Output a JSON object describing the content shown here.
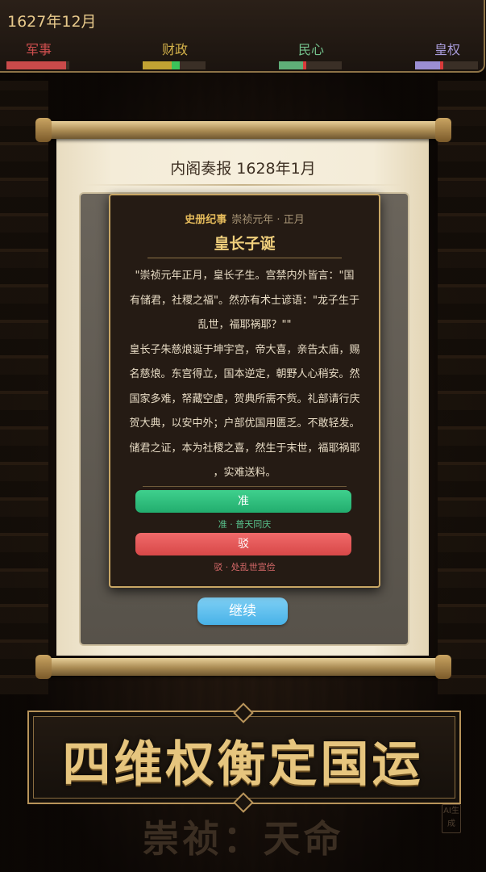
{
  "top_bar": {
    "date": "1627年12月",
    "stats": [
      {
        "label": "军事",
        "color": "#c94a4a",
        "fill_fraction": 0.95,
        "tick_color": null
      },
      {
        "label": "财政",
        "color": "#c2a233",
        "fill_fraction": 0.46,
        "tick_color": "#3cc45a"
      },
      {
        "label": "民心",
        "color": "#5fae78",
        "fill_fraction": 0.38,
        "tick_color": "#d83b3b"
      },
      {
        "label": "皇权",
        "color": "#9b8ed3",
        "fill_fraction": 0.4,
        "tick_color": "#d83b3b"
      }
    ]
  },
  "report": {
    "title": "内阁奏报  1628年1月",
    "continue_label": "继续"
  },
  "modal": {
    "head_key": "史册纪事",
    "head_value": "崇祯元年 · 正月",
    "title": "皇长子诞",
    "body": "\"崇祯元年正月，皇长子生。宫禁内外皆言：\"国\n有储君，社稷之福\"。然亦有术士谚语：\"龙子生于\n乱世，福耶祸耶？\"\"\n皇长子朱慈烺诞于坤宇宫，帝大喜，亲告太庙，赐\n名慈烺。东宫得立，国本逆定，朝野人心稍安。然\n国家多难，帑藏空虚，贺典所需不赀。礼部请行庆\n贺大典，以安中外；户部优国用匮乏。不敢轻发。\n储君之证，本为社稷之喜，然生于末世，福耶祸耶\n，实难送料。",
    "accept_label": "准",
    "accept_hint": "准 · 普天同庆",
    "reject_label": "驳",
    "reject_hint": "驳 · 处乱世宣俭"
  },
  "banner": {
    "text": "四维权衡定国运",
    "watermark": "崇祯：天命",
    "badge": "AI生成"
  }
}
